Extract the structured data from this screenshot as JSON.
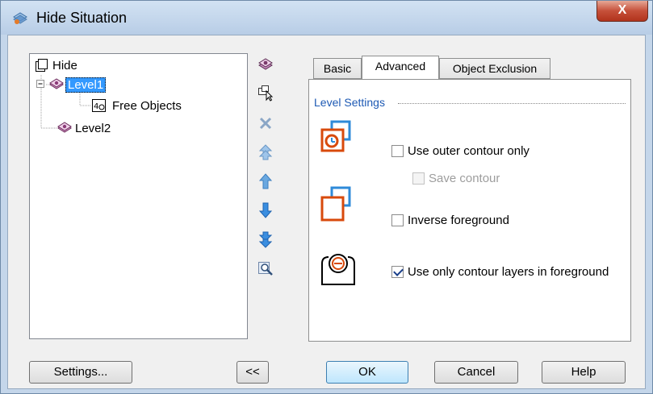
{
  "window": {
    "title": "Hide Situation",
    "close_label": "X"
  },
  "tree": {
    "root": "Hide",
    "level1": "Level1",
    "free_objects": "Free Objects",
    "level2": "Level2"
  },
  "toolbar": {
    "icons": [
      "layers-icon",
      "select-objects-icon",
      "delete-icon",
      "move-top-icon",
      "move-up-icon",
      "move-down-icon",
      "move-bottom-icon",
      "zoom-icon"
    ]
  },
  "tabs": [
    "Basic",
    "Advanced",
    "Object Exclusion"
  ],
  "active_tab": "Advanced",
  "group": {
    "header": "Level Settings"
  },
  "options": {
    "outer_contour": {
      "label": "Use outer contour only",
      "checked": false
    },
    "save_contour": {
      "label": "Save contour",
      "checked": false,
      "enabled": false
    },
    "inverse_foreground": {
      "label": "Inverse foreground",
      "checked": false
    },
    "contour_layers": {
      "label": "Use only contour layers in foreground",
      "checked": true
    }
  },
  "buttons": {
    "settings": "Settings...",
    "collapse": "<<",
    "ok": "OK",
    "cancel": "Cancel",
    "help": "Help"
  },
  "colors": {
    "selection": "#3399ff",
    "accent_orange": "#d84a0c",
    "accent_blue": "#2e8ad8"
  }
}
